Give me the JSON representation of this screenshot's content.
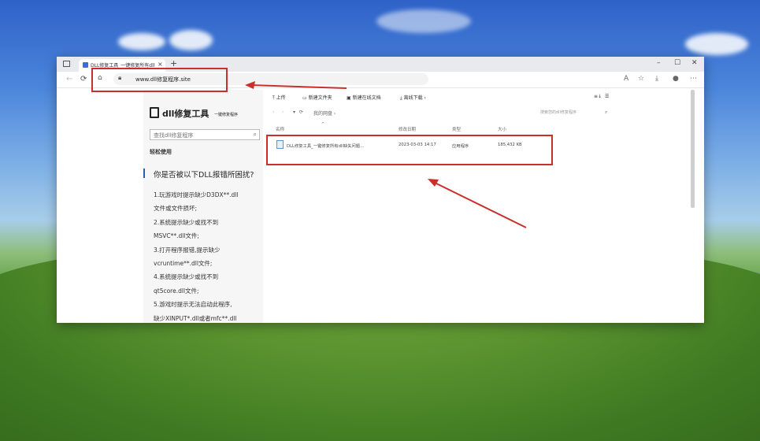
{
  "browser": {
    "tab_title": "DLL修复工具_一键修复所有dll缺失问题",
    "tab_close": "×",
    "new_tab": "+",
    "url": "www.dll修复程序.site",
    "win_min": "–",
    "win_max": "☐",
    "win_close": "✕"
  },
  "left_pane": {
    "logo_title": "dll修复工具",
    "logo_subtitle": "一键修复程序",
    "search_placeholder": "查找dll修复程序",
    "section_label": "轻松使用",
    "question": "你是否被以下DLL报错所困扰?",
    "lines": [
      "1.玩游戏时提示缺少D3DX**.dll",
      "文件或文件损坏;",
      "2.系统提示缺少或找不到",
      "MSVC**.dll文件;",
      "3.打开程序报错,提示缺少",
      "vcruntime**.dll文件;",
      "4.系统提示缺少或找不到",
      "qt5core.dll文件;",
      "5.游戏时提示无法启动此程序,",
      "缺少XINPUT*.dll或者mfc**.dll"
    ]
  },
  "right_pane": {
    "toolbar": {
      "upload": "上传",
      "new_folder": "新建文件夹",
      "new_doc": "新建在线文档",
      "offline_download": "离线下载"
    },
    "path": {
      "root": "我的网盘",
      "search_placeholder": "搜索您的dll修复程序"
    },
    "columns": {
      "name": "名称",
      "modified": "修改日期",
      "type": "类型",
      "size": "大小"
    },
    "file": {
      "name": "DLL修复工具_一键修复所有dll缺失问题...",
      "modified": "2023-03-03 14:17",
      "type": "应用程序",
      "size": "185,432 KB"
    }
  },
  "colors": {
    "highlight": "#c9302c",
    "accent": "#2a5db0"
  }
}
